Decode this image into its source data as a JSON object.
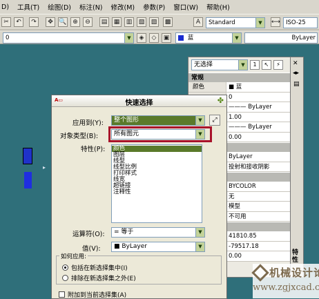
{
  "menubar": {
    "items": [
      "D)",
      "工具(T)",
      "绘图(D)",
      "标注(N)",
      "修改(M)",
      "参数(P)",
      "窗口(W)",
      "帮助(H)"
    ]
  },
  "toolbar": {
    "text_style": "Standard",
    "dim_style": "ISO-25",
    "layer_value": "0",
    "color_value": "蓝",
    "linetype_value": "ByLayer"
  },
  "properties_palette": {
    "selection": "无选择",
    "side_label": "特性",
    "sections": [
      {
        "title": "常规",
        "rows": [
          {
            "key": "颜色",
            "value": "■ 蓝"
          },
          {
            "key": "",
            "value": "0"
          },
          {
            "key": "",
            "value": "——— ByLayer"
          },
          {
            "key": "",
            "value": "1.00"
          },
          {
            "key": "",
            "value": "——— ByLayer"
          },
          {
            "key": "",
            "value": "0.00"
          }
        ]
      },
      {
        "title": "",
        "rows": [
          {
            "key": "",
            "value": "ByLayer"
          },
          {
            "key": "",
            "value": "投射和接收阴影"
          }
        ]
      },
      {
        "title": "",
        "rows": [
          {
            "key": "",
            "value": "BYCOLOR"
          },
          {
            "key": "",
            "value": "无"
          },
          {
            "key": "",
            "value": "模型"
          },
          {
            "key": "",
            "value": "不可用"
          }
        ]
      },
      {
        "title": "",
        "rows": [
          {
            "key": "",
            "value": "41810.85"
          },
          {
            "key": "",
            "value": "-79517.18"
          },
          {
            "key": "",
            "value": "0.00"
          }
        ]
      }
    ]
  },
  "dialog": {
    "title": "快速选择",
    "apply_to_label": "应用到(Y):",
    "apply_to_value": "整个图形",
    "object_type_label": "对象类型(B):",
    "object_type_value": "所有图元",
    "properties_label": "特性(P):",
    "properties": [
      "颜色",
      "图层",
      "线型",
      "线型比例",
      "打印样式",
      "线宽",
      "超链接",
      "注释性"
    ],
    "operator_label": "运算符(O):",
    "operator_value": "= 等于",
    "value_label": "值(V):",
    "value_value": "■ ByLayer",
    "how_apply_label": "如何应用:",
    "radio_include": "包括在新选择集中(I)",
    "radio_exclude": "排除在新选择集之外(E)",
    "append_label": "附加到当前选择集(A)"
  },
  "watermark": {
    "line1": "机械设计论坛",
    "line2": "www.zgjxcad.com"
  }
}
